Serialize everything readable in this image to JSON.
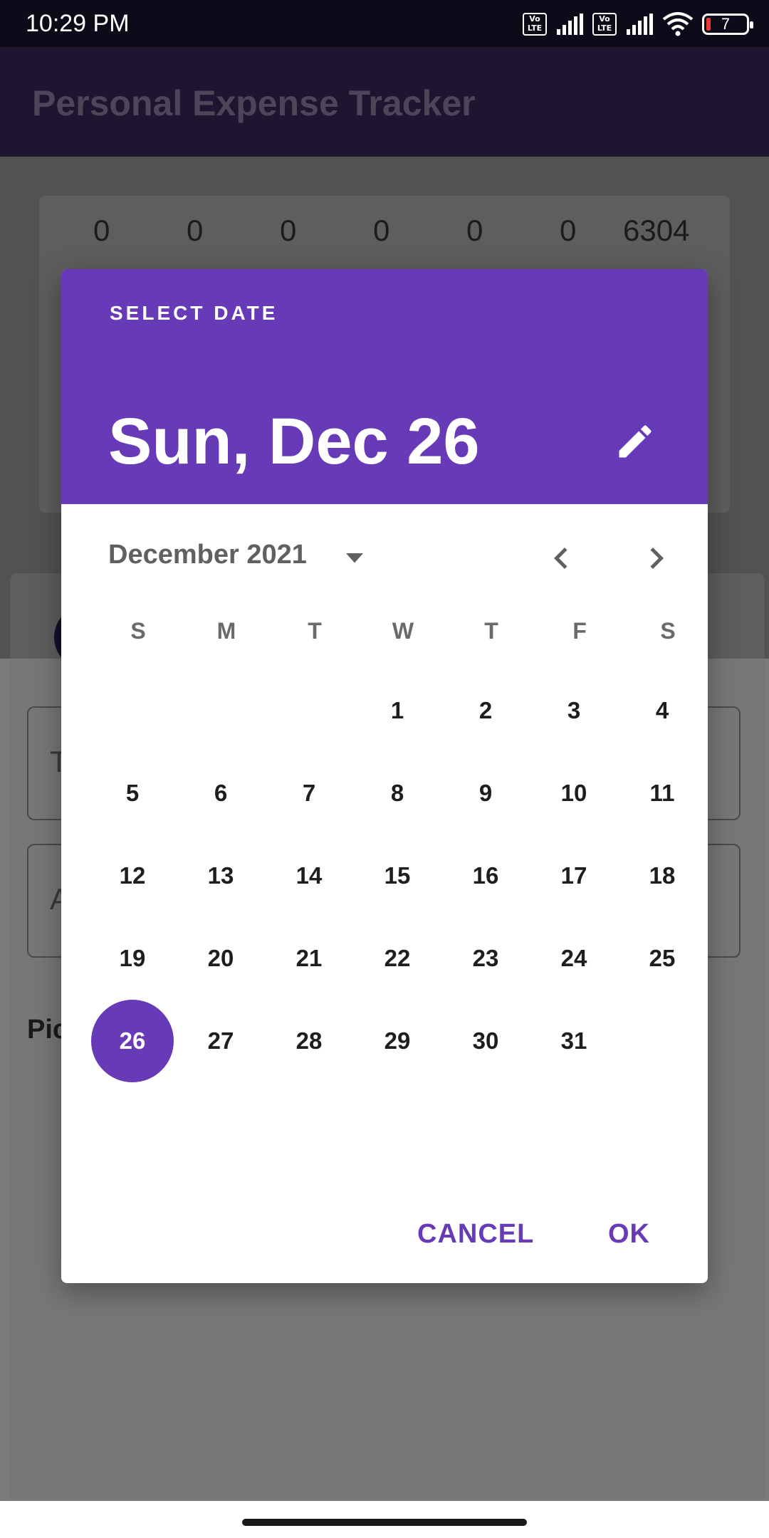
{
  "status_bar": {
    "time": "10:29 PM",
    "sim1_badge": "Vo\nLTE",
    "sim2_badge": "Vo\nLTE",
    "battery_level": "7",
    "icons": [
      "volte-icon",
      "signal-icon",
      "volte-icon",
      "signal-icon",
      "wifi-icon",
      "battery-icon"
    ]
  },
  "app_bar": {
    "title": "Personal Expense Tracker"
  },
  "background": {
    "counts": [
      "0",
      "0",
      "0",
      "0",
      "0",
      "0",
      "6304"
    ],
    "field1_peek": "T",
    "field2_peek": "A",
    "pick_peek": "Pic"
  },
  "dialog": {
    "header_label": "SELECT DATE",
    "selected_date_text": "Sun, Dec 26",
    "month_year": "December 2021",
    "weekdays": [
      "S",
      "M",
      "T",
      "W",
      "T",
      "F",
      "S"
    ],
    "days": [
      "1",
      "2",
      "3",
      "4",
      "5",
      "6",
      "7",
      "8",
      "9",
      "10",
      "11",
      "12",
      "13",
      "14",
      "15",
      "16",
      "17",
      "18",
      "19",
      "20",
      "21",
      "22",
      "23",
      "24",
      "25",
      "26",
      "27",
      "28",
      "29",
      "30",
      "31"
    ],
    "first_weekday_index": 3,
    "selected_day": "26",
    "cancel_label": "CANCEL",
    "ok_label": "OK",
    "accent_color": "#673ab7",
    "icons": [
      "edit-icon",
      "dropdown-caret-icon",
      "chevron-left-icon",
      "chevron-right-icon"
    ]
  }
}
